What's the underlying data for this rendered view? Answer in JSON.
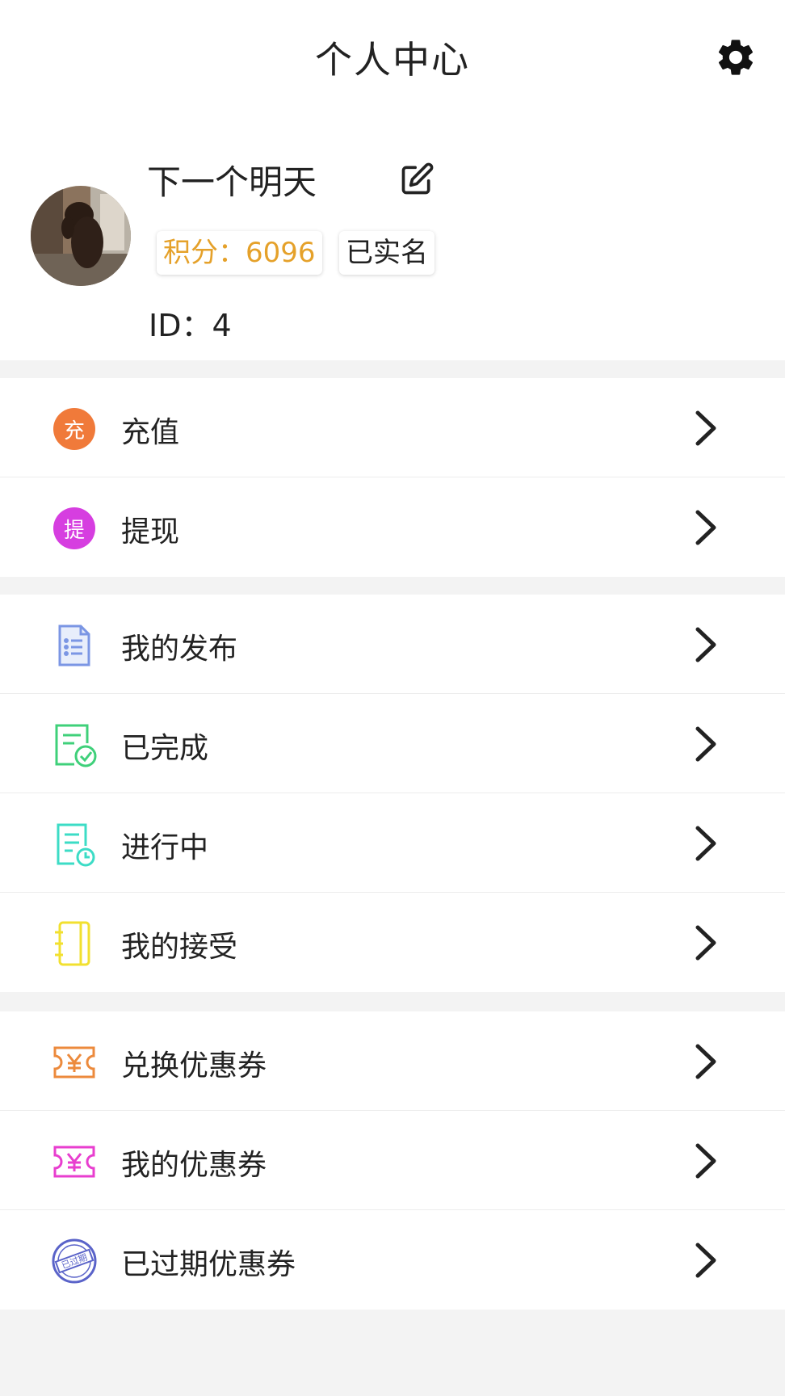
{
  "header": {
    "title": "个人中心",
    "settings_icon": "gear-icon"
  },
  "profile": {
    "nickname": "下一个明天",
    "points_badge": "积分：6096",
    "verified_badge": "已实名",
    "id_text": "ID：4",
    "colors": {
      "points": "#e5a12a"
    }
  },
  "groups": [
    {
      "items": [
        {
          "label": "充值",
          "icon": "recharge-icon",
          "icon_text": "充",
          "color": "#f07a3a"
        },
        {
          "label": "提现",
          "icon": "withdraw-icon",
          "icon_text": "提",
          "color": "#d63ee0"
        }
      ]
    },
    {
      "items": [
        {
          "label": "我的发布",
          "icon": "document-list-icon",
          "color": "#7b96e4"
        },
        {
          "label": "已完成",
          "icon": "document-check-icon",
          "color": "#3fd07a"
        },
        {
          "label": "进行中",
          "icon": "document-clock-icon",
          "color": "#3cdcc6"
        },
        {
          "label": "我的接受",
          "icon": "notebook-icon",
          "color": "#f2e030"
        }
      ]
    },
    {
      "items": [
        {
          "label": "兑换优惠券",
          "icon": "coupon-exchange-icon",
          "color": "#ec8a3c"
        },
        {
          "label": "我的优惠券",
          "icon": "coupon-icon",
          "color": "#e83ecf"
        },
        {
          "label": "已过期优惠券",
          "icon": "expired-stamp-icon",
          "stamp_text": "已过期",
          "color": "#5a63c9"
        }
      ]
    }
  ]
}
